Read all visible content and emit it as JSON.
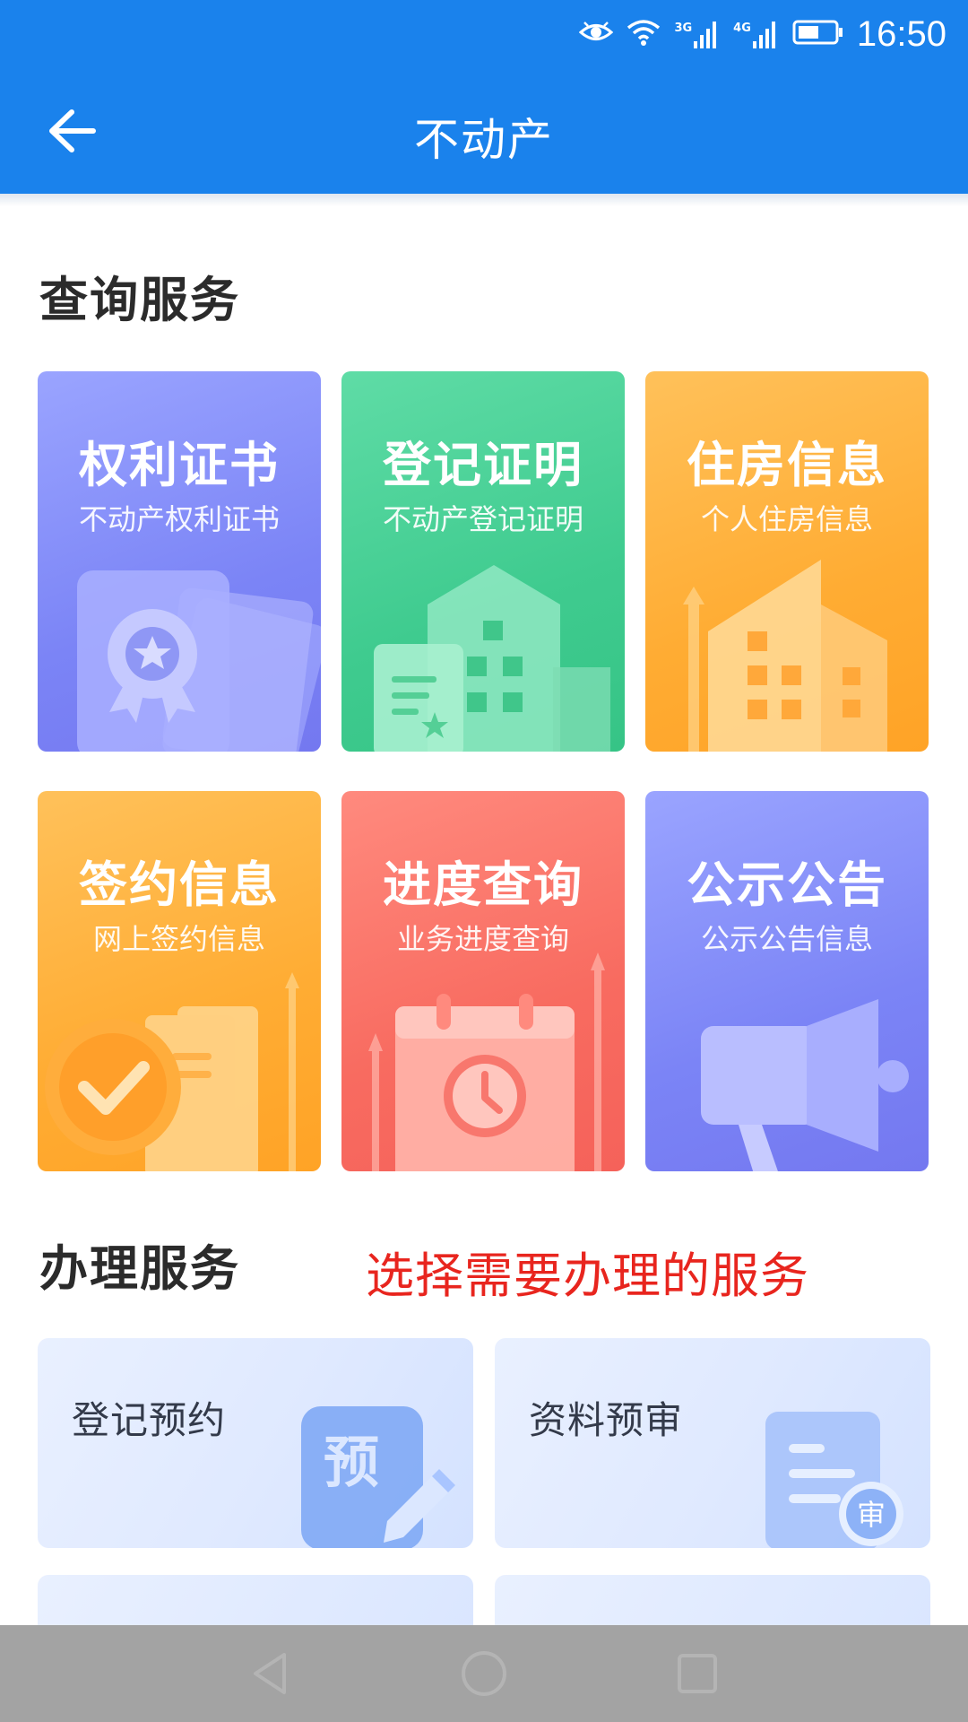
{
  "status_bar": {
    "time": "16:50",
    "signal_1_tag": "3G",
    "signal_2_tag": "4G",
    "icons": [
      "eye-icon",
      "wifi-icon",
      "signal-icon",
      "signal-icon",
      "battery-icon"
    ]
  },
  "header": {
    "title": "不动产",
    "back_icon": "arrow-left-icon",
    "color": "#1a82ec"
  },
  "query_section": {
    "title": "查询服务",
    "tiles": [
      {
        "title": "权利证书",
        "subtitle": "不动产权利证书",
        "icon": "certificate-icon"
      },
      {
        "title": "登记证明",
        "subtitle": "不动产登记证明",
        "icon": "building-icon"
      },
      {
        "title": "住房信息",
        "subtitle": "个人住房信息",
        "icon": "house-icon"
      },
      {
        "title": "签约信息",
        "subtitle": "网上签约信息",
        "icon": "check-document-icon"
      },
      {
        "title": "进度查询",
        "subtitle": "业务进度查询",
        "icon": "calendar-clock-icon"
      },
      {
        "title": "公示公告",
        "subtitle": "公示公告信息",
        "icon": "megaphone-icon"
      }
    ]
  },
  "process_section": {
    "title": "办理服务",
    "annotation": "选择需要办理的服务",
    "cards": [
      {
        "label": "登记预约",
        "icon": "reservation-icon",
        "icon_text": "预"
      },
      {
        "label": "资料预审",
        "icon": "document-review-icon",
        "icon_text": "审"
      }
    ]
  },
  "nav_bar": {
    "icons": [
      "nav-back-icon",
      "nav-home-icon",
      "nav-recent-icon"
    ]
  }
}
